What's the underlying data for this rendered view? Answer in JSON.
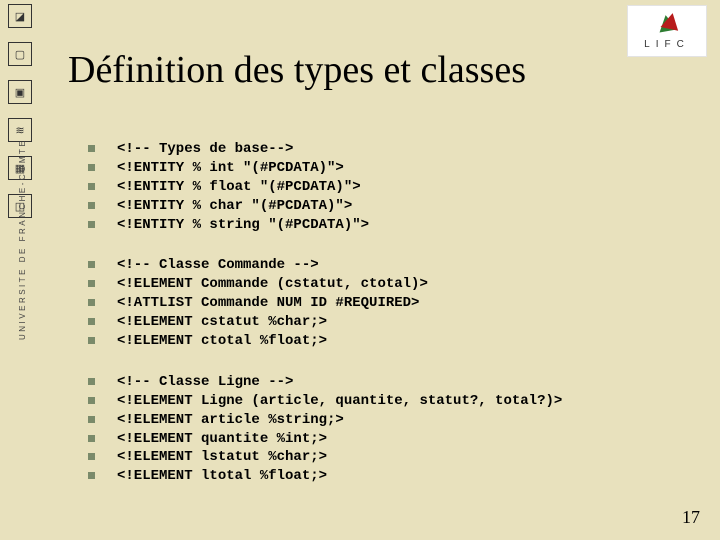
{
  "sidebar": {
    "label": "UNIVERSITE DE FRANCHE-COMTE"
  },
  "logo": {
    "text": "LIFC"
  },
  "title": "Définition des types et classes",
  "groups": [
    {
      "lines": [
        "<!-- Types de base-->",
        "<!ENTITY % int \"(#PCDATA)\">",
        "<!ENTITY % float \"(#PCDATA)\">",
        "<!ENTITY % char \"(#PCDATA)\">",
        "<!ENTITY % string \"(#PCDATA)\">"
      ]
    },
    {
      "lines": [
        "<!-- Classe Commande -->",
        "<!ELEMENT Commande (cstatut, ctotal)>",
        "<!ATTLIST Commande NUM ID #REQUIRED>",
        "<!ELEMENT cstatut %char;>",
        "<!ELEMENT ctotal %float;>"
      ]
    },
    {
      "lines": [
        "<!-- Classe Ligne -->",
        "<!ELEMENT Ligne (article, quantite, statut?, total?)>",
        "<!ELEMENT article %string;>",
        "<!ELEMENT quantite %int;>",
        "<!ELEMENT lstatut %char;>",
        "<!ELEMENT ltotal %float;>"
      ]
    }
  ],
  "page_number": "17"
}
